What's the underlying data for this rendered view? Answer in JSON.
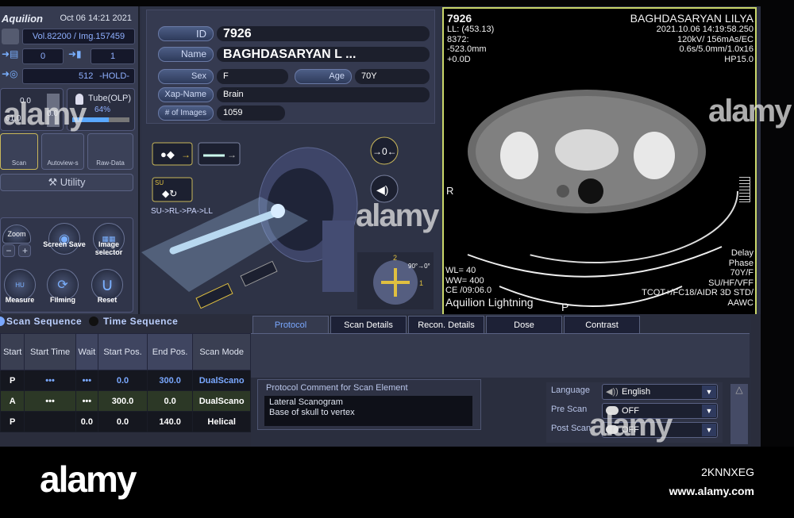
{
  "header": {
    "brand": "Aquilion",
    "datetime": "Oct 06 14:21 2021"
  },
  "status": {
    "volume": "Vol.82200",
    "image": "/ Img.157459",
    "print_count": "0",
    "film_count": "1",
    "matrix": "512",
    "hold": "-HOLD-",
    "gauge_a": "0.0",
    "gauge_b": "0.0",
    "gauge_c": "61.0",
    "tube_label": "Tube(OLP)",
    "tube_percent_text": "64%",
    "tube_percent": 64
  },
  "modes": [
    "Scan",
    "Autoview-s",
    "Raw-Data"
  ],
  "utility_label": "Utility",
  "tools": {
    "zoom": "Zoom",
    "minus": "−",
    "plus": "+",
    "screen_save": "Screen Save",
    "image_selector": "Image selector",
    "measure": "Measure",
    "measure_badge": "HU",
    "filming": "Filming",
    "reset": "Reset"
  },
  "patient": {
    "id_label": "ID",
    "id": "7926",
    "name_label": "Name",
    "name": "BAGHDASARYAN L ...",
    "sex_label": "Sex",
    "sex": "F",
    "age_label": "Age",
    "age": "70Y",
    "xap_label": "Xap-Name",
    "xap": "Brain",
    "images_label": "# of Images",
    "images": "1059"
  },
  "gantry": {
    "su_badge": "SU",
    "sequence": "SU->RL->PA->LL",
    "zero_label": "→0←",
    "angle": "90°→0°",
    "pos_top": "2",
    "pos_right": "1"
  },
  "ct_image": {
    "id": "7926",
    "patient": "BAGHDASARYAN LILYA",
    "ll": "LL: (453.13)",
    "n": "8372:",
    "pos": "-523.0mm",
    "tilt": "+0.0D",
    "date": "2021.10.06 14:19:58.250",
    "kv": "120kV/ 156mAs/EC",
    "slice": "0.6s/5.0mm/1.0x16",
    "hp": "HP15.0",
    "side": "R",
    "wl": "WL= 40",
    "ww": "WW= 400",
    "ce": "CE /09:06.0",
    "model": "Aquilion Lightning",
    "p": "P",
    "delay": "Delay",
    "phase": "Phase",
    "age_sex": "70Y/F",
    "orient": "SU/HF/VFF",
    "recon": "TCOT+/FC18/AIDR 3D STD/",
    "aawc": "AAWC"
  },
  "sequence": {
    "scan_sequence": "Scan Sequence",
    "time_sequence": "Time Sequence",
    "columns": [
      "Start",
      "Start Time",
      "Wait",
      "Start Pos.",
      "End Pos.",
      "Scan Mode"
    ],
    "rows": [
      [
        "P",
        "•••",
        "•••",
        "0.0",
        "300.0",
        "DualScano"
      ],
      [
        "A",
        "•••",
        "•••",
        "300.0",
        "0.0",
        "DualScano"
      ],
      [
        "P",
        "",
        "0.0",
        "0.0",
        "140.0",
        "Helical"
      ]
    ]
  },
  "tabs": [
    "Protocol",
    "Scan Details",
    "Recon. Details",
    "Dose",
    "Contrast"
  ],
  "protocol": {
    "comment_title": "Protocol Comment for Scan Element",
    "comment_lines": [
      "Lateral Scanogram",
      "Base of skull to vertex"
    ],
    "language_label": "Language",
    "language": "English",
    "pre_scan_label": "Pre Scan",
    "pre_scan": "OFF",
    "post_scan_label": "Post Scan",
    "post_scan": "OFF"
  },
  "watermark": {
    "logo": "alamy",
    "image_id": "2KNNXEG",
    "url": "www.alamy.com"
  }
}
